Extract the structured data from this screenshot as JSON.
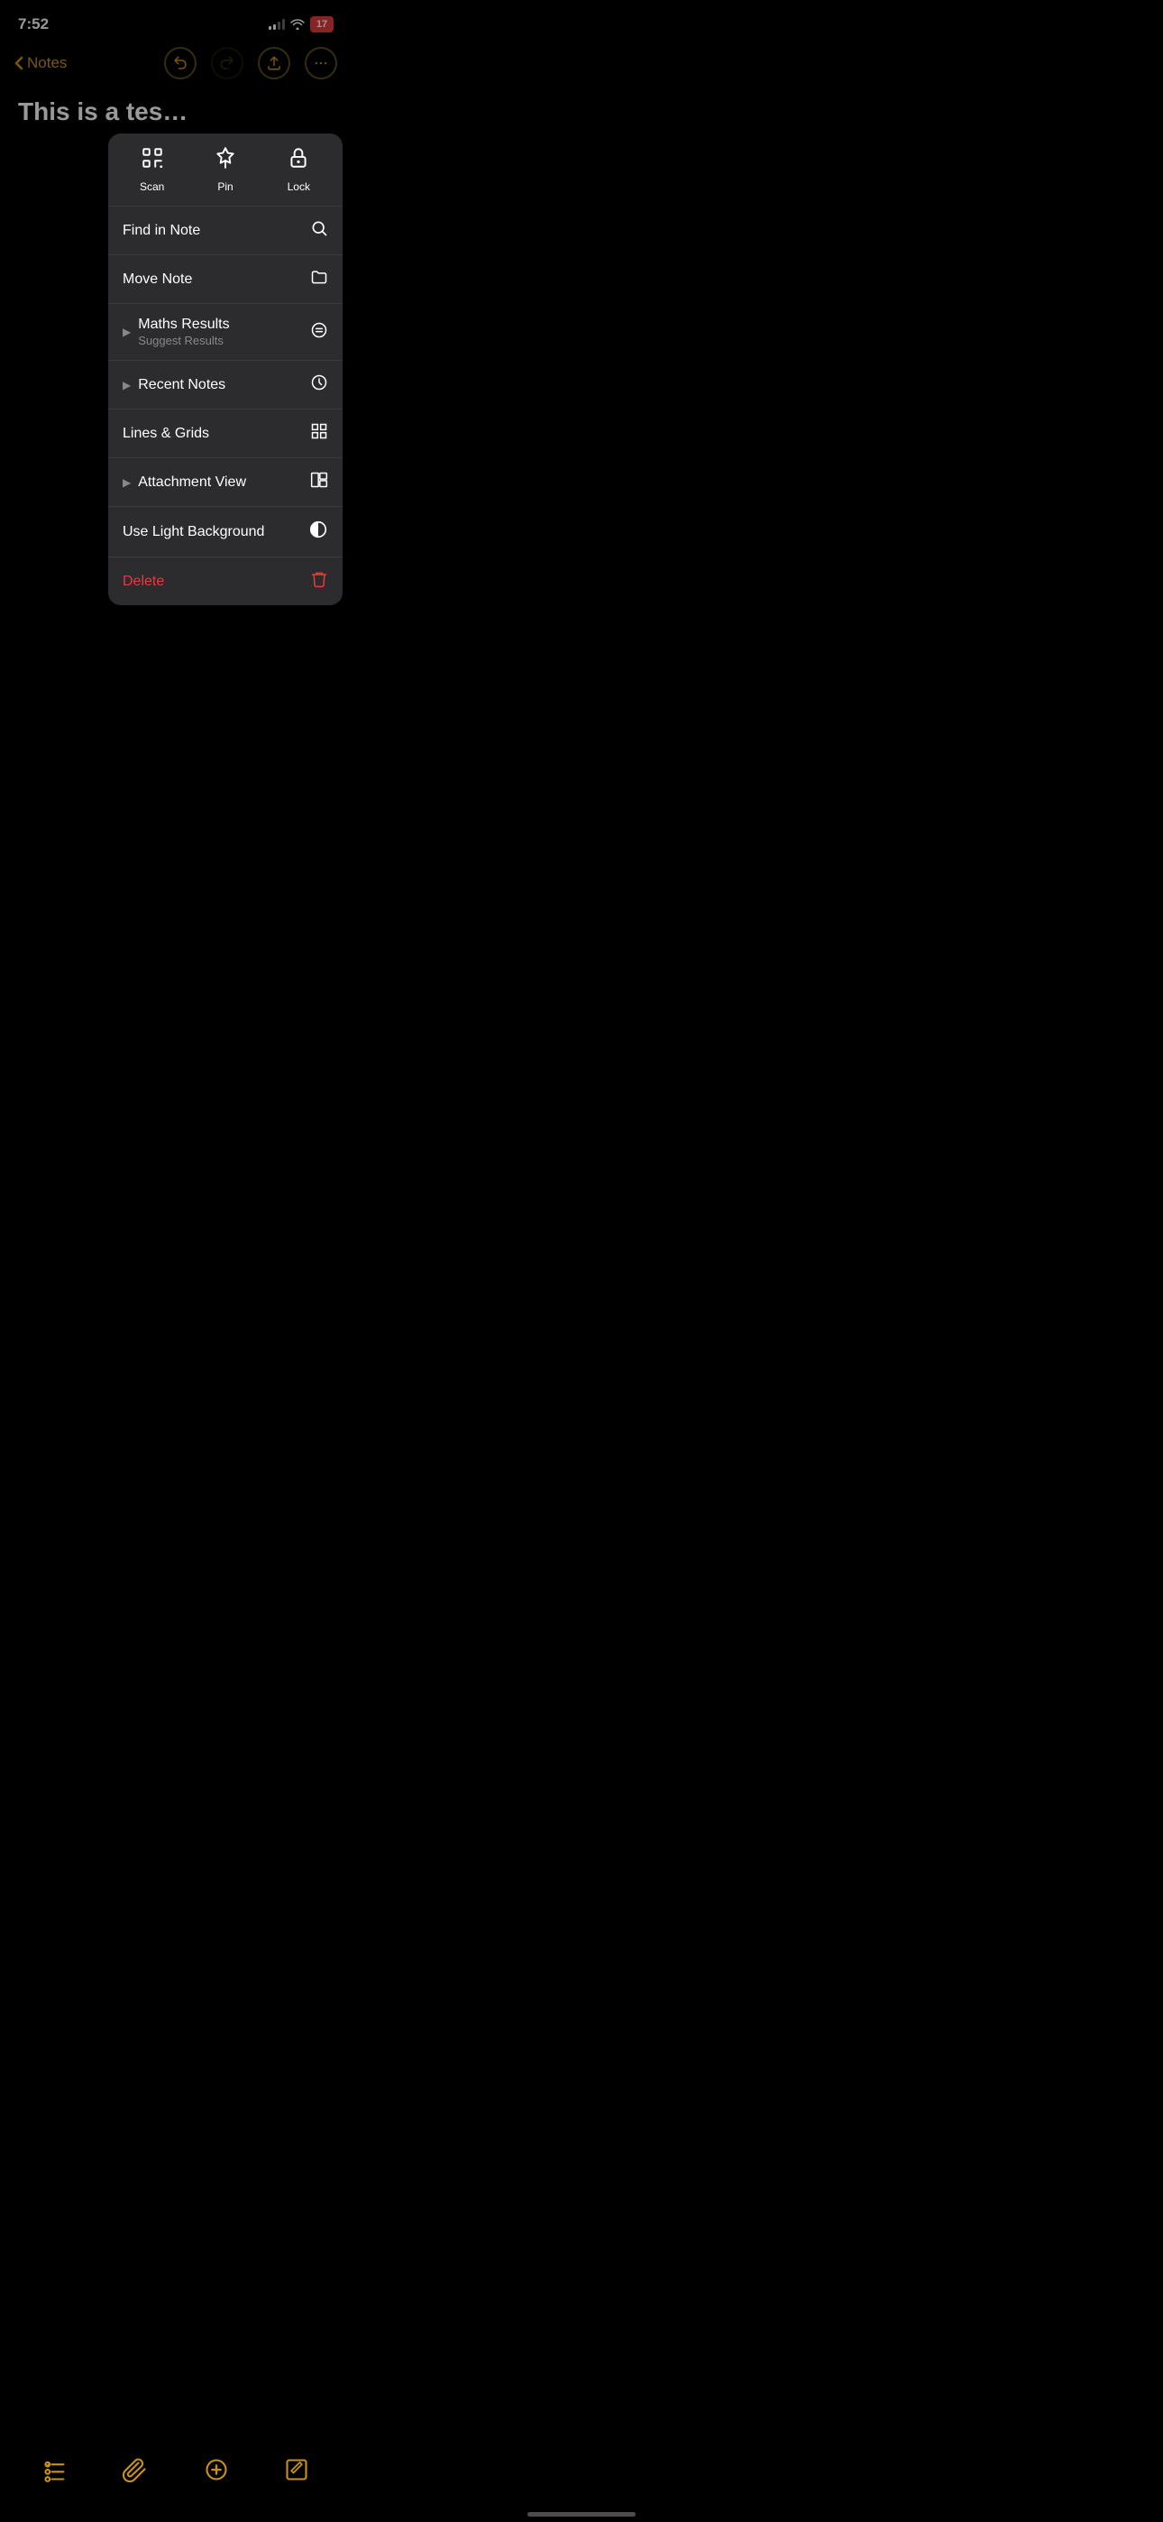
{
  "status": {
    "time": "7:52",
    "battery": "17"
  },
  "nav": {
    "back_label": "Notes",
    "undo_label": "undo",
    "redo_label": "redo",
    "share_label": "share",
    "more_label": "more"
  },
  "note": {
    "title": "This is a tes…"
  },
  "menu": {
    "top_items": [
      {
        "id": "scan",
        "label": "Scan",
        "icon": "scan"
      },
      {
        "id": "pin",
        "label": "Pin",
        "icon": "pin"
      },
      {
        "id": "lock",
        "label": "Lock",
        "icon": "lock"
      }
    ],
    "items": [
      {
        "id": "find-in-note",
        "label": "Find in Note",
        "sublabel": "",
        "icon": "search",
        "has_chevron": false
      },
      {
        "id": "move-note",
        "label": "Move Note",
        "sublabel": "",
        "icon": "folder",
        "has_chevron": false
      },
      {
        "id": "maths-results",
        "label": "Maths Results",
        "sublabel": "Suggest Results",
        "icon": "equal-circle",
        "has_chevron": true
      },
      {
        "id": "recent-notes",
        "label": "Recent Notes",
        "sublabel": "",
        "icon": "clock",
        "has_chevron": true
      },
      {
        "id": "lines-grids",
        "label": "Lines & Grids",
        "sublabel": "",
        "icon": "grid",
        "has_chevron": false
      },
      {
        "id": "attachment-view",
        "label": "Attachment View",
        "sublabel": "",
        "icon": "attachment",
        "has_chevron": true
      },
      {
        "id": "use-light-bg",
        "label": "Use Light Background",
        "sublabel": "",
        "icon": "half-circle",
        "has_chevron": false
      },
      {
        "id": "delete",
        "label": "Delete",
        "sublabel": "",
        "icon": "trash",
        "has_chevron": false,
        "is_delete": true
      }
    ]
  },
  "toolbar": {
    "checklist_label": "checklist",
    "attachment_label": "attachment",
    "compose_label": "compose",
    "edit_label": "edit"
  }
}
